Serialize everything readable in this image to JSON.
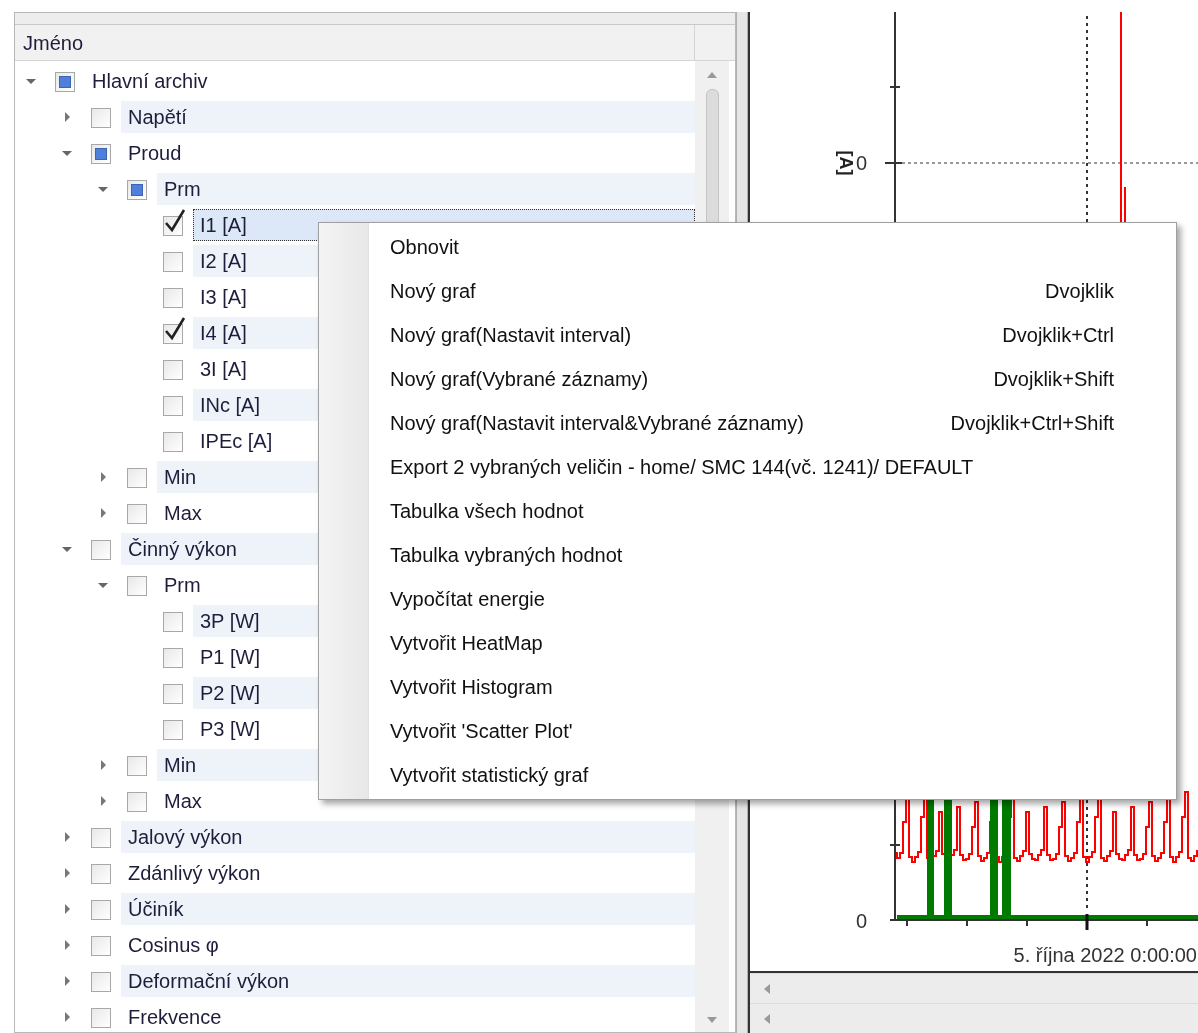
{
  "tree": {
    "column_header": "Jméno",
    "items": [
      {
        "label": "Hlavní archiv",
        "checked": false,
        "indeterminate": true,
        "expanded": true,
        "selected": false,
        "children": [
          {
            "label": "Napětí",
            "checked": false,
            "indeterminate": false,
            "expanded": false,
            "selected": false
          },
          {
            "label": "Proud",
            "checked": false,
            "indeterminate": true,
            "expanded": true,
            "selected": false,
            "children": [
              {
                "label": "Prm",
                "checked": false,
                "indeterminate": true,
                "expanded": true,
                "selected": false,
                "children": [
                  {
                    "label": "I1 [A]",
                    "checked": true,
                    "indeterminate": false,
                    "selected": true
                  },
                  {
                    "label": "I2 [A]",
                    "checked": false,
                    "indeterminate": false,
                    "selected": false
                  },
                  {
                    "label": "I3 [A]",
                    "checked": false,
                    "indeterminate": false,
                    "selected": false
                  },
                  {
                    "label": "I4 [A]",
                    "checked": true,
                    "indeterminate": false,
                    "selected": false
                  },
                  {
                    "label": "3I [A]",
                    "checked": false,
                    "indeterminate": false,
                    "selected": false
                  },
                  {
                    "label": "INc [A]",
                    "checked": false,
                    "indeterminate": false,
                    "selected": false
                  },
                  {
                    "label": "IPEc [A]",
                    "checked": false,
                    "indeterminate": false,
                    "selected": false
                  }
                ]
              },
              {
                "label": "Min",
                "checked": false,
                "indeterminate": false,
                "expanded": false,
                "selected": false
              },
              {
                "label": "Max",
                "checked": false,
                "indeterminate": false,
                "expanded": false,
                "selected": false
              }
            ]
          },
          {
            "label": "Činný výkon",
            "checked": false,
            "indeterminate": false,
            "expanded": true,
            "selected": false,
            "children": [
              {
                "label": "Prm",
                "checked": false,
                "indeterminate": false,
                "expanded": true,
                "selected": false,
                "children": [
                  {
                    "label": "3P [W]",
                    "checked": false,
                    "indeterminate": false,
                    "selected": false
                  },
                  {
                    "label": "P1 [W]",
                    "checked": false,
                    "indeterminate": false,
                    "selected": false
                  },
                  {
                    "label": "P2 [W]",
                    "checked": false,
                    "indeterminate": false,
                    "selected": false
                  },
                  {
                    "label": "P3 [W]",
                    "checked": false,
                    "indeterminate": false,
                    "selected": false
                  }
                ]
              },
              {
                "label": "Min",
                "checked": false,
                "indeterminate": false,
                "expanded": false,
                "selected": false
              },
              {
                "label": "Max",
                "checked": false,
                "indeterminate": false,
                "expanded": false,
                "selected": false
              }
            ]
          },
          {
            "label": "Jalový výkon",
            "checked": false,
            "indeterminate": false,
            "expanded": false,
            "selected": false
          },
          {
            "label": "Zdánlivý výkon",
            "checked": false,
            "indeterminate": false,
            "expanded": false,
            "selected": false
          },
          {
            "label": "Účiník",
            "checked": false,
            "indeterminate": false,
            "expanded": false,
            "selected": false
          },
          {
            "label": "Cosinus φ",
            "checked": false,
            "indeterminate": false,
            "expanded": false,
            "selected": false
          },
          {
            "label": "Deformační výkon",
            "checked": false,
            "indeterminate": false,
            "expanded": false,
            "selected": false
          },
          {
            "label": "Frekvence",
            "checked": false,
            "indeterminate": false,
            "expanded": false,
            "selected": false
          }
        ]
      }
    ]
  },
  "chart": {
    "y_unit": "[A]",
    "y_tick_labels": [
      "0",
      "0"
    ],
    "x_label": "5. října 2022 0:00:00"
  },
  "context_menu": [
    {
      "label": "Obnovit"
    },
    {
      "label": "Nový graf",
      "shortcut": "Dvojklik"
    },
    {
      "label": "Nový graf(Nastavit interval)",
      "shortcut": "Dvojklik+Ctrl"
    },
    {
      "label": "Nový graf(Vybrané záznamy)",
      "shortcut": "Dvojklik+Shift"
    },
    {
      "label": "Nový graf(Nastavit interval&Vybrané záznamy)",
      "shortcut": "Dvojklik+Ctrl+Shift"
    },
    {
      "label": "Export 2 vybraných veličin - home/ SMC 144(vč. 1241)/ DEFAULT"
    },
    {
      "label": "Tabulka všech hodnot"
    },
    {
      "label": "Tabulka vybraných hodnot"
    },
    {
      "label": "Vypočítat energie"
    },
    {
      "label": "Vytvořit HeatMap"
    },
    {
      "label": "Vytvořit Histogram"
    },
    {
      "label": "Vytvořit 'Scatter Plot'"
    },
    {
      "label": "Vytvořit statistický graf"
    }
  ]
}
